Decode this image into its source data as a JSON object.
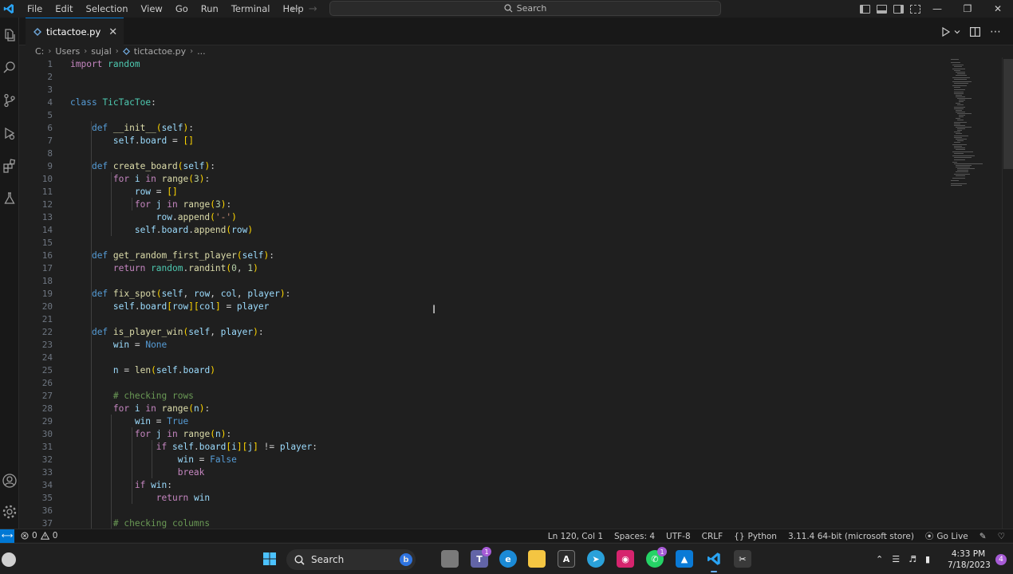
{
  "titlebar": {
    "menu": [
      "File",
      "Edit",
      "Selection",
      "View",
      "Go",
      "Run",
      "Terminal",
      "Help"
    ],
    "search_label": "Search"
  },
  "tab": {
    "label": "tictactoe.py"
  },
  "breadcrumb": {
    "drive": "C:",
    "users": "Users",
    "user": "sujal",
    "file": "tictactoe.py",
    "more": "..."
  },
  "editor": {
    "line_numbers": [
      "1",
      "2",
      "3",
      "4",
      "5",
      "6",
      "7",
      "8",
      "9",
      "10",
      "11",
      "12",
      "13",
      "14",
      "15",
      "16",
      "17",
      "18",
      "19",
      "20",
      "21",
      "22",
      "23",
      "24",
      "25",
      "26",
      "27",
      "28",
      "29",
      "30",
      "31",
      "32",
      "33",
      "34",
      "35",
      "36",
      "37"
    ]
  },
  "statusbar": {
    "errors": "0",
    "warnings": "0",
    "position": "Ln 120, Col 1",
    "spaces": "Spaces: 4",
    "encoding": "UTF-8",
    "eol": "CRLF",
    "language": "Python",
    "interpreter": "3.11.4 64-bit (microsoft store)",
    "golive": "Go Live"
  },
  "taskbar": {
    "search_label": "Search",
    "time": "4:33 PM",
    "date": "7/18/2023",
    "notifications": "4",
    "teams_badge": "1",
    "whatsapp_badge": "1"
  },
  "colors": {
    "accent": "#0078d4",
    "keyword": "#569cd6",
    "function": "#dcdcaa",
    "class": "#4ec9b0",
    "comment": "#6a9955"
  }
}
